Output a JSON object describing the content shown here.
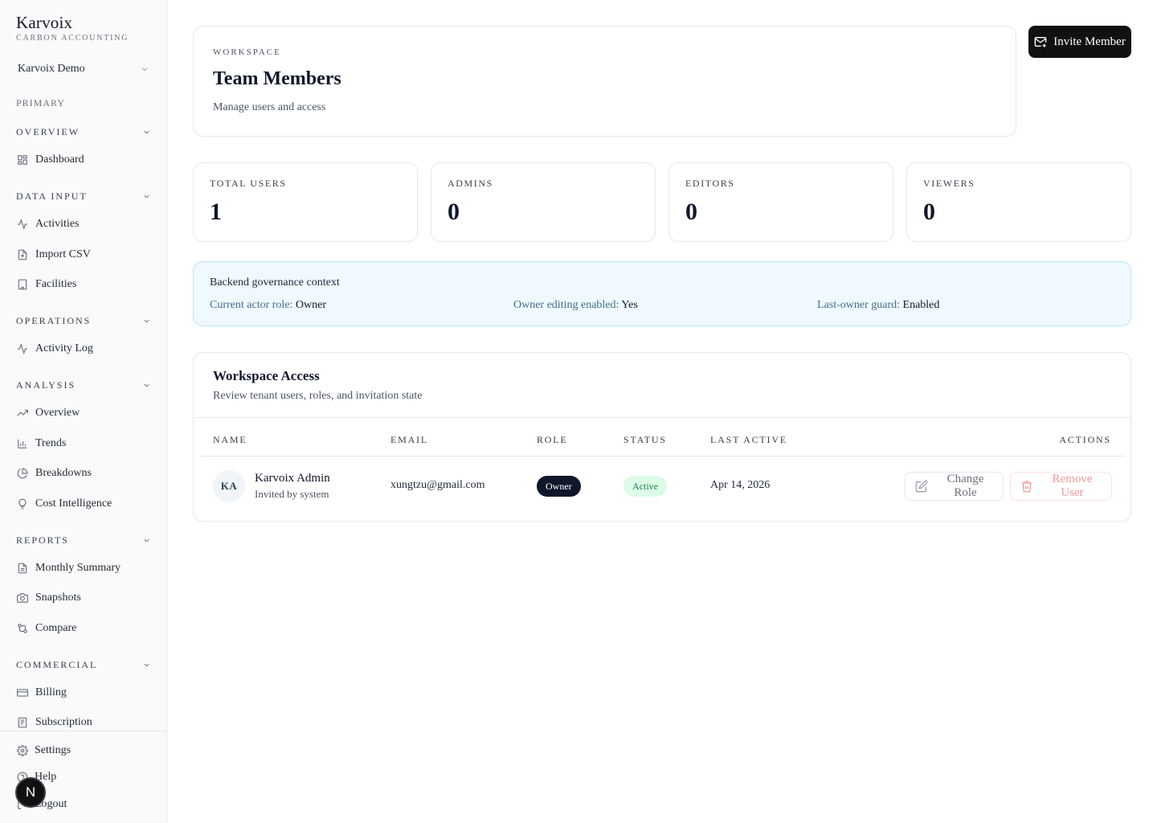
{
  "brand": {
    "name": "Karvoix",
    "subtitle": "CARBON ACCOUNTING"
  },
  "workspace_select": {
    "value": "Karvoix Demo"
  },
  "sidebar": {
    "primary_label": "PRIMARY",
    "sections": [
      {
        "title": "OVERVIEW",
        "items": [
          {
            "label": "Dashboard",
            "icon": "dashboard-icon"
          }
        ]
      },
      {
        "title": "DATA INPUT",
        "items": [
          {
            "label": "Activities",
            "icon": "activity-icon"
          },
          {
            "label": "Import CSV",
            "icon": "file-upload-icon"
          },
          {
            "label": "Facilities",
            "icon": "building-icon"
          }
        ]
      },
      {
        "title": "OPERATIONS",
        "items": [
          {
            "label": "Activity Log",
            "icon": "activity-icon"
          }
        ]
      },
      {
        "title": "ANALYSIS",
        "items": [
          {
            "label": "Overview",
            "icon": "trending-up-icon"
          },
          {
            "label": "Trends",
            "icon": "bar-chart-icon"
          },
          {
            "label": "Breakdowns",
            "icon": "pie-chart-icon"
          },
          {
            "label": "Cost Intelligence",
            "icon": "lightbulb-icon"
          }
        ]
      },
      {
        "title": "REPORTS",
        "items": [
          {
            "label": "Monthly Summary",
            "icon": "file-text-icon"
          },
          {
            "label": "Snapshots",
            "icon": "camera-icon"
          },
          {
            "label": "Compare",
            "icon": "compare-icon"
          }
        ]
      },
      {
        "title": "COMMERCIAL",
        "items": [
          {
            "label": "Billing",
            "icon": "credit-card-icon"
          },
          {
            "label": "Subscription",
            "icon": "receipt-icon"
          }
        ]
      }
    ],
    "footer": [
      {
        "label": "Settings",
        "icon": "gear-icon"
      },
      {
        "label": "Help",
        "icon": "help-icon"
      },
      {
        "label": "Logout",
        "icon": "logout-icon"
      }
    ],
    "fab_label": "N"
  },
  "header": {
    "eyebrow": "WORKSPACE",
    "title": "Team Members",
    "subtitle": "Manage users and access",
    "invite_label": "Invite Member"
  },
  "stats": [
    {
      "label": "TOTAL USERS",
      "value": "1"
    },
    {
      "label": "ADMINS",
      "value": "0"
    },
    {
      "label": "EDITORS",
      "value": "0"
    },
    {
      "label": "VIEWERS",
      "value": "0"
    }
  ],
  "governance": {
    "title": "Backend governance context",
    "items": [
      {
        "key": "Current actor role:",
        "value": "Owner"
      },
      {
        "key": "Owner editing enabled:",
        "value": "Yes"
      },
      {
        "key": "Last-owner guard:",
        "value": "Enabled"
      }
    ]
  },
  "access": {
    "title": "Workspace Access",
    "subtitle": "Review tenant users, roles, and invitation state",
    "columns": [
      "NAME",
      "EMAIL",
      "ROLE",
      "STATUS",
      "LAST ACTIVE",
      "ACTIONS"
    ],
    "rows": [
      {
        "initials": "KA",
        "name": "Karvoix Admin",
        "invited_by": "Invited by system",
        "email": "xungtzu@gmail.com",
        "role": "Owner",
        "status": "Active",
        "last_active": "Apr 14, 2026",
        "change_role_label": "Change Role",
        "remove_label": "Remove User"
      }
    ]
  },
  "colors": {
    "accent": "#111111",
    "status_active_bg": "#dcfce7",
    "status_active_text": "#15803d",
    "gov_bg": "#f0f9ff",
    "danger": "#f19a9a"
  }
}
